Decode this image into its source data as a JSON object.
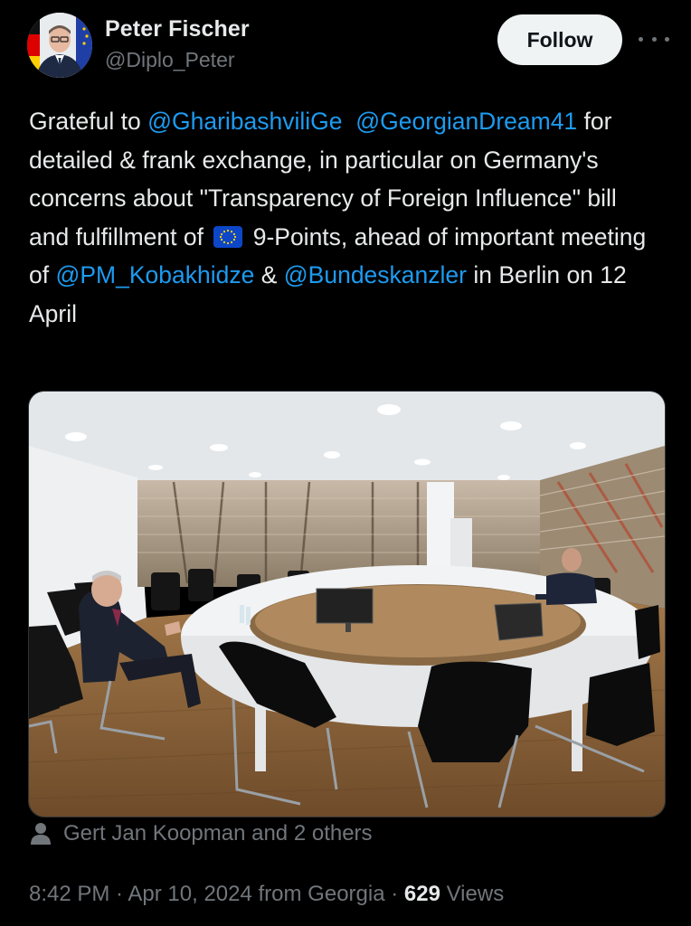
{
  "author": {
    "display_name": "Peter Fischer",
    "handle": "@Diplo_Peter"
  },
  "actions": {
    "follow_label": "Follow",
    "more_icon": "more-horizontal-icon"
  },
  "tweet": {
    "seg1": "Grateful to ",
    "mention1": "@GharibashviliGe",
    "seg2": "  ",
    "mention2": "@GeorgianDream41",
    "seg3": " for detailed & frank exchange, in particular on Germany's concerns about \"Transparency of Foreign Influence\" bill and fulfillment of ",
    "flag_icon": "eu-flag-emoji",
    "seg4": " 9-Points, ahead of important meeting of ",
    "mention3": "@PM_Kobakhidze",
    "seg5": " & ",
    "mention4": "@Bundeskanzler",
    "seg6": " in Berlin on 12 April"
  },
  "tagged": {
    "icon": "person-icon",
    "text": "Gert Jan Koopman and 2 others"
  },
  "meta": {
    "time": "8:42 PM",
    "sep1": " · ",
    "date": "Apr 10, 2024 from Georgia",
    "sep2": " · ",
    "views_count": "629",
    "views_label": " Views"
  },
  "colors": {
    "background": "#000000",
    "text": "#e7e9ea",
    "secondary": "#71767b",
    "link": "#1d9bf0",
    "follow_bg": "#eff3f4"
  }
}
